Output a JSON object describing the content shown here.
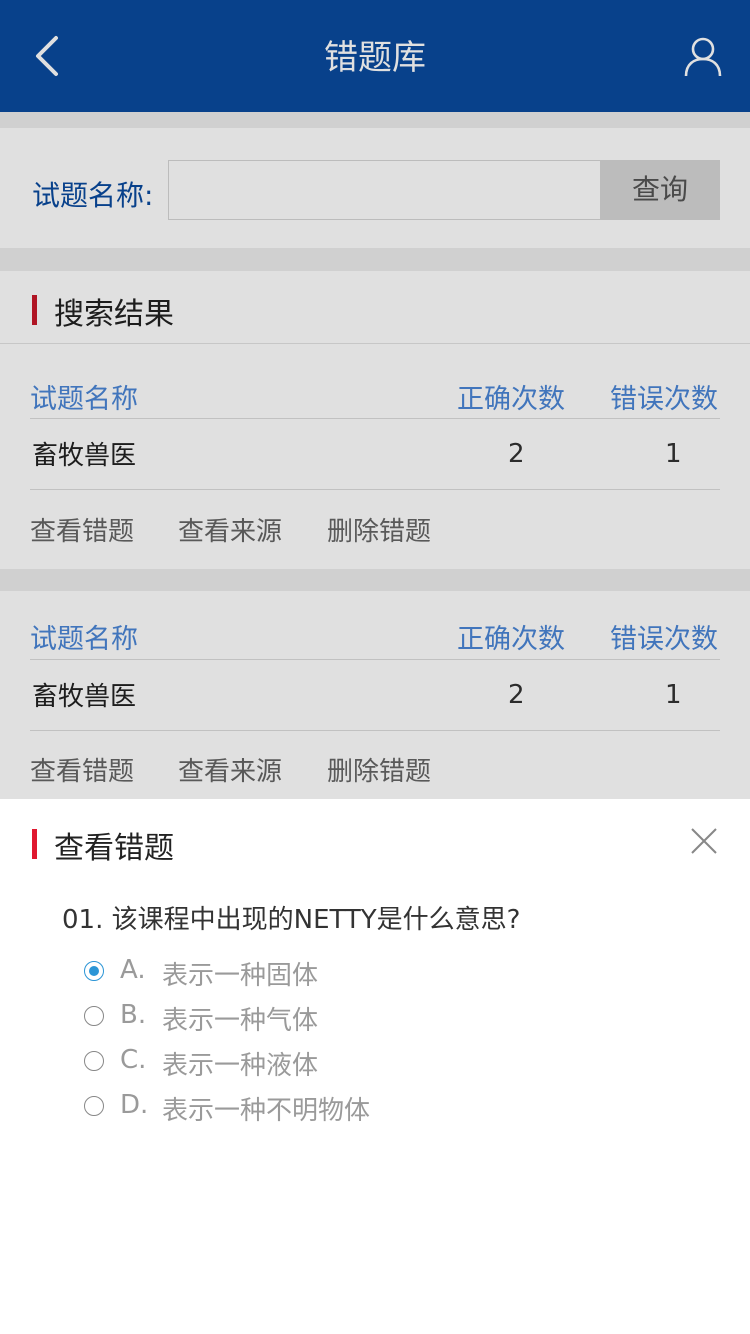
{
  "header": {
    "title": "错题库",
    "back_icon": "chevron-left-icon",
    "user_icon": "user-icon"
  },
  "search": {
    "label": "试题名称:",
    "input_value": "",
    "button_label": "查询"
  },
  "results": {
    "section_title": "搜索结果",
    "columns": {
      "name": "试题名称",
      "correct": "正确次数",
      "wrong": "错误次数"
    },
    "items": [
      {
        "name": "畜牧兽医",
        "correct": "2",
        "wrong": "1",
        "actions": [
          "查看错题",
          "查看来源",
          "删除错题"
        ]
      },
      {
        "name": "畜牧兽医",
        "correct": "2",
        "wrong": "1",
        "actions": [
          "查看错题",
          "查看来源",
          "删除错题"
        ]
      }
    ]
  },
  "sheet": {
    "title": "查看错题",
    "close_icon": "close-icon",
    "question": "01. 该课程中出现的NETTY是什么意思?",
    "options": [
      {
        "letter": "A.",
        "text": "表示一种固体",
        "checked": true
      },
      {
        "letter": "B.",
        "text": "表示一种气体",
        "checked": false
      },
      {
        "letter": "C.",
        "text": "表示一种液体",
        "checked": false
      },
      {
        "letter": "D.",
        "text": "表示一种不明物体",
        "checked": false
      }
    ]
  },
  "colors": {
    "header_bg": "#0a4a9f",
    "accent_red": "#c9182a",
    "column_header": "#4a86d6",
    "radio_checked": "#2b95d6"
  }
}
